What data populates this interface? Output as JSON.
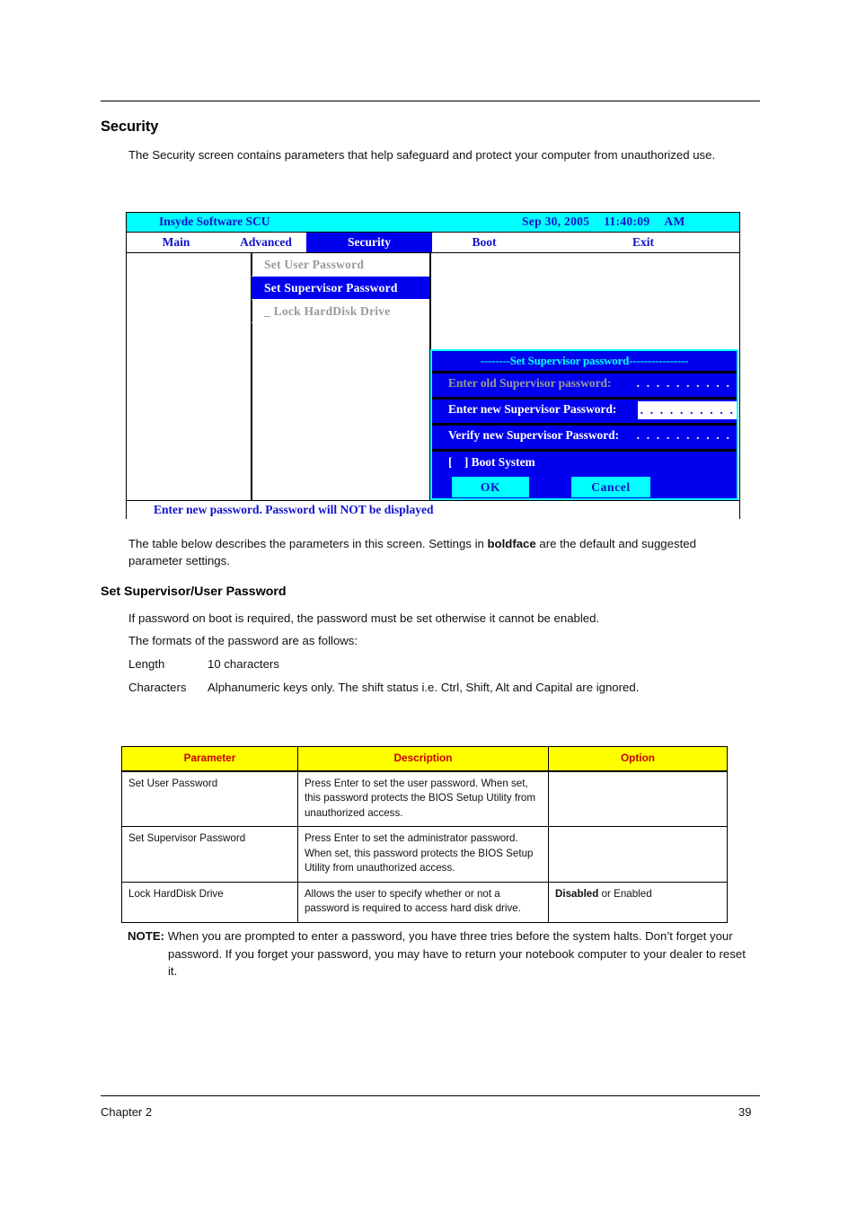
{
  "document": {
    "section_title": "Security",
    "intro_paragraph": "The Security screen contains parameters that help safeguard and protect your computer from unauthorized use.",
    "table_intro_prefix": "The table below describes the parameters in this screen. Settings in ",
    "table_intro_bold": "boldface",
    "table_intro_suffix": " are the default and suggested parameter settings.",
    "subsection_title": "Set Supervisor/User Password",
    "password_required_line": "If password on boot is required, the password must be set otherwise it cannot be enabled.",
    "formats_line": "The formats of the password are as follows:",
    "format_rows": [
      {
        "label": "Length",
        "value": "10 characters"
      },
      {
        "label": "Characters",
        "value": "Alphanumeric keys only. The shift status i.e. Ctrl, Shift, Alt and Capital are ignored."
      }
    ]
  },
  "bios": {
    "title_bar": {
      "app_name": "Insyde Software SCU",
      "date": "Sep 30, 2005",
      "time": "11:40:09",
      "meridiem": "AM"
    },
    "tabs": [
      {
        "label": "Main",
        "active": false
      },
      {
        "label": "Advanced",
        "active": false
      },
      {
        "label": "Security",
        "active": true
      },
      {
        "label": "Boot",
        "active": false
      },
      {
        "label": "Exit",
        "active": false
      }
    ],
    "menu_items": [
      {
        "label": "Set User Password",
        "selected": false
      },
      {
        "label": "Set Supervisor Password",
        "selected": true
      },
      {
        "label": "_ Lock HardDisk Drive",
        "selected": false
      }
    ],
    "dialog": {
      "title": "--------Set Supervisor password----------------",
      "rows": [
        {
          "label": "Enter old Supervisor password:",
          "dots": ". . . . . . . . . .",
          "state": "disabled",
          "field_style": "plain"
        },
        {
          "label": "Enter new Supervisor Password:",
          "dots": ". . . . . . . . . .",
          "state": "active",
          "field_style": "boxed"
        },
        {
          "label": "Verify new Supervisor Password:",
          "dots": ". . . . . . . . . .",
          "state": "active",
          "field_style": "plain"
        }
      ],
      "checkbox_label": "[    ] Boot System",
      "ok_label": "OK",
      "cancel_label": "Cancel"
    },
    "status_text": "Enter new password. Password will NOT be displayed",
    "colors": {
      "title_bar_bg": "#00ffff",
      "accent_blue": "#0000ee",
      "text_blue": "#1111cc",
      "dimmed_text": "#9a9a9a"
    }
  },
  "parameter_table": {
    "headers": [
      "Parameter",
      "Description",
      "Option"
    ],
    "header_bg": "#ffff00",
    "header_color": "#cc0000",
    "rows": [
      {
        "parameter": "Set User Password",
        "description": "Press Enter to set the user password. When set, this password protects the BIOS Setup Utility from unauthorized access.",
        "option_bold": "",
        "option_rest": ""
      },
      {
        "parameter": "Set Supervisor Password",
        "description": "Press Enter to set the administrator password. When set, this password protects the BIOS Setup Utility from unauthorized access.",
        "option_bold": "",
        "option_rest": ""
      },
      {
        "parameter": "Lock HardDisk Drive",
        "description": "Allows the user to specify whether or not a password is required to access hard disk drive.",
        "option_bold": "Disabled",
        "option_rest": " or Enabled"
      }
    ]
  },
  "note": {
    "label": "NOTE:",
    "text": "When you are prompted to enter a password, you have three tries before the system halts. Don’t forget your password. If you forget your password, you may have to return your notebook computer to your dealer to reset it."
  },
  "footer": {
    "chapter": "Chapter 2",
    "page_number": "39"
  }
}
